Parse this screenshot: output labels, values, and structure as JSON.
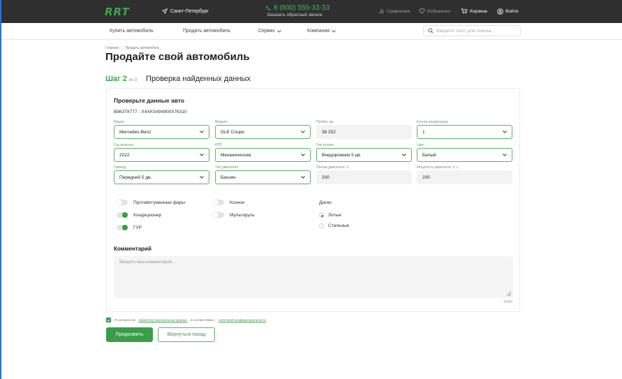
{
  "header": {
    "logo": "RRT",
    "city": "Санкт-Петербург",
    "phone": "8 (800) 555-33-33",
    "callback": "Заказать обратный звонок",
    "compare": "Сравнение",
    "favorites": "Избранное",
    "cart": "Корзина",
    "login": "Войти"
  },
  "menu": {
    "buy": "Купить автомобиль",
    "sell": "Продать автомобиль",
    "service": "Сервис",
    "company": "Компания",
    "search_placeholder": "Введите текст для поиска..."
  },
  "breadcrumb": [
    "Главная",
    "Продать автомобиль"
  ],
  "page_title": "Продайте свой автомобиль",
  "step": {
    "label": "Шаг 2",
    "of": "из 3",
    "name": "Проверка найденных данных"
  },
  "card": {
    "title": "Проверьте данные авто",
    "plate_vin": "В863ТК777  -  X4XKS494900X76310",
    "fields": [
      {
        "label": "Марка",
        "value": "Mercedes-Benz"
      },
      {
        "label": "Модель",
        "value": "GLE Coupe"
      },
      {
        "label": "Пробег, км",
        "value": "38 252"
      },
      {
        "label": "Кол-во владельцев",
        "value": "1"
      },
      {
        "label": "Год выпуска",
        "value": "2022"
      },
      {
        "label": "КПП",
        "value": "Механическая"
      },
      {
        "label": "Тип кузова",
        "value": "Внедорожник 5 дв."
      },
      {
        "label": "Цвет",
        "value": "Белый"
      },
      {
        "label": "Привод",
        "value": "Передний 5 дв."
      },
      {
        "label": "Тип двигателя",
        "value": "Бензин"
      },
      {
        "label": "Объем двигателя, л",
        "value": "200"
      },
      {
        "label": "Мощность двигателя, л. с.",
        "value": "200"
      }
    ],
    "options": [
      {
        "label": "Противотуманные фары",
        "on": false
      },
      {
        "label": "Ксенон",
        "on": false
      },
      {
        "label": "Кондиционер",
        "on": true
      },
      {
        "label": "Мультируль",
        "on": false
      },
      {
        "label": "ГУР",
        "on": true
      }
    ],
    "discs": {
      "title": "Диски",
      "options": [
        {
          "label": "Литые",
          "selected": true
        },
        {
          "label": "Стальные",
          "selected": false
        }
      ]
    },
    "comment_title": "Комментарий",
    "comment_placeholder": "Введите ваш комментарий...",
    "counter": "0/200"
  },
  "consent": {
    "prefix": "Я согласен на",
    "link1": "обработку персональных данных",
    "middle": "в соответствии с",
    "link2": "политикой конфиденциальности",
    "checked": true
  },
  "buttons": {
    "continue": "Продолжить",
    "back": "Вернуться назад"
  },
  "colors": {
    "accent": "#3a9d48",
    "header_bg": "#2f2f2f",
    "readonly_bg": "#f3f3f3"
  }
}
